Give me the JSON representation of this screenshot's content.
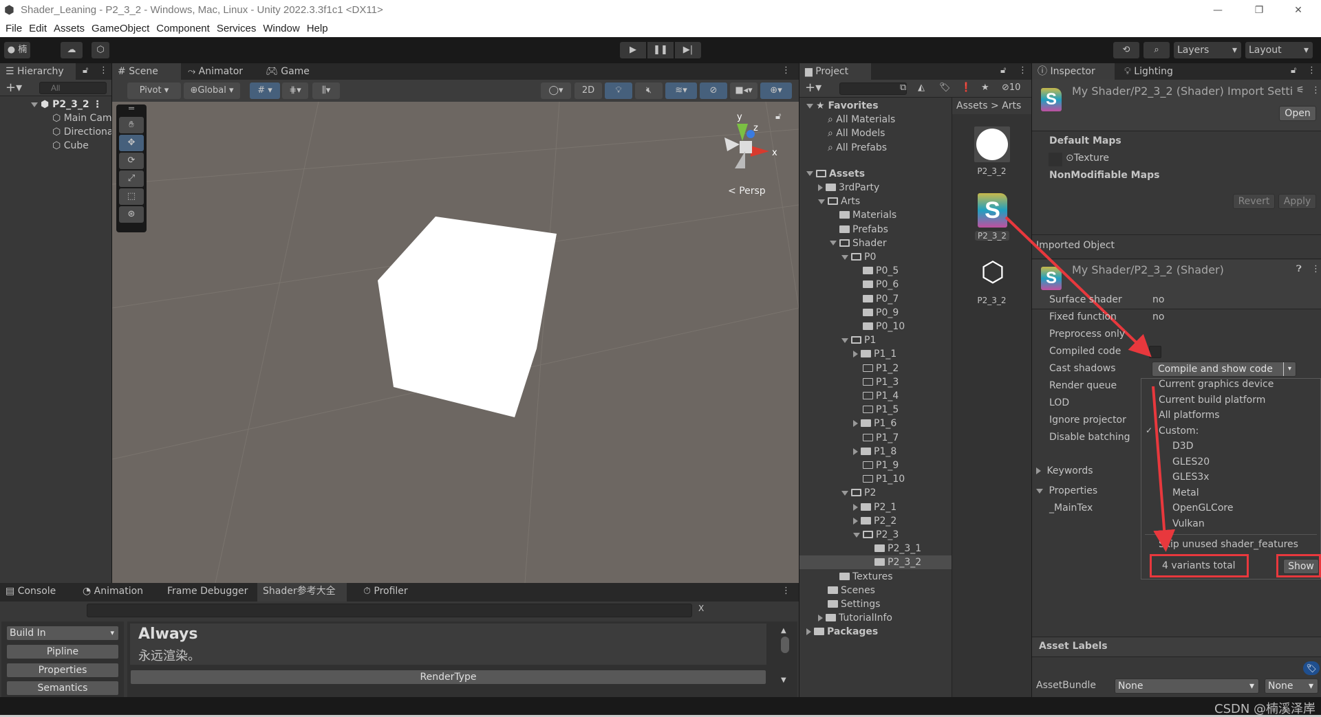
{
  "window": {
    "title": "Shader_Leaning - P2_3_2 - Windows, Mac, Linux - Unity 2022.3.3f1c1 <DX11>",
    "min": "—",
    "max": "❐",
    "close": "✕"
  },
  "menu": [
    "File",
    "Edit",
    "Assets",
    "GameObject",
    "Component",
    "Services",
    "Window",
    "Help"
  ],
  "toolbar": {
    "account": "楠",
    "layers": "Layers",
    "layout": "Layout"
  },
  "hierarchy": {
    "tab": "Hierarchy",
    "search_placeholder": "All",
    "scene": "P2_3_2",
    "items": [
      "Main Camera",
      "Directional Light",
      "Cube"
    ]
  },
  "scene": {
    "tabs": [
      "Scene",
      "Animator",
      "Game"
    ],
    "pivot": "Pivot",
    "global": "Global",
    "mode2d": "2D",
    "persp": "Persp",
    "axes": {
      "x": "x",
      "y": "y",
      "z": "z"
    }
  },
  "project": {
    "tab": "Project",
    "breadcrumb": [
      "Assets",
      "Arts"
    ],
    "hidden_count": "10",
    "tree": [
      {
        "label": "Favorites",
        "depth": 0,
        "type": "fav",
        "state": "open"
      },
      {
        "label": "All Materials",
        "depth": 1,
        "type": "search"
      },
      {
        "label": "All Models",
        "depth": 1,
        "type": "search"
      },
      {
        "label": "All Prefabs",
        "depth": 1,
        "type": "search"
      },
      {
        "label": "Assets",
        "depth": 0,
        "type": "folder",
        "state": "open",
        "gap": true
      },
      {
        "label": "3rdParty",
        "depth": 1,
        "type": "folder",
        "state": "closed"
      },
      {
        "label": "Arts",
        "depth": 1,
        "type": "folder",
        "state": "open"
      },
      {
        "label": "Materials",
        "depth": 2,
        "type": "folder"
      },
      {
        "label": "Prefabs",
        "depth": 2,
        "type": "folder"
      },
      {
        "label": "Shader",
        "depth": 2,
        "type": "folder",
        "state": "open"
      },
      {
        "label": "P0",
        "depth": 3,
        "type": "folder",
        "state": "open"
      },
      {
        "label": "P0_5",
        "depth": 4,
        "type": "folder"
      },
      {
        "label": "P0_6",
        "depth": 4,
        "type": "folder"
      },
      {
        "label": "P0_7",
        "depth": 4,
        "type": "folder"
      },
      {
        "label": "P0_9",
        "depth": 4,
        "type": "folder"
      },
      {
        "label": "P0_10",
        "depth": 4,
        "type": "folder"
      },
      {
        "label": "P1",
        "depth": 3,
        "type": "folder",
        "state": "open"
      },
      {
        "label": "P1_1",
        "depth": 4,
        "type": "folder",
        "state": "closed"
      },
      {
        "label": "P1_2",
        "depth": 4,
        "type": "emptyfolder"
      },
      {
        "label": "P1_3",
        "depth": 4,
        "type": "emptyfolder"
      },
      {
        "label": "P1_4",
        "depth": 4,
        "type": "emptyfolder"
      },
      {
        "label": "P1_5",
        "depth": 4,
        "type": "emptyfolder"
      },
      {
        "label": "P1_6",
        "depth": 4,
        "type": "folder",
        "state": "closed"
      },
      {
        "label": "P1_7",
        "depth": 4,
        "type": "emptyfolder"
      },
      {
        "label": "P1_8",
        "depth": 4,
        "type": "folder",
        "state": "closed"
      },
      {
        "label": "P1_9",
        "depth": 4,
        "type": "emptyfolder"
      },
      {
        "label": "P1_10",
        "depth": 4,
        "type": "emptyfolder"
      },
      {
        "label": "P2",
        "depth": 3,
        "type": "folder",
        "state": "open"
      },
      {
        "label": "P2_1",
        "depth": 4,
        "type": "folder",
        "state": "closed"
      },
      {
        "label": "P2_2",
        "depth": 4,
        "type": "folder",
        "state": "closed"
      },
      {
        "label": "P2_3",
        "depth": 4,
        "type": "folder",
        "state": "open"
      },
      {
        "label": "P2_3_1",
        "depth": 5,
        "type": "folder"
      },
      {
        "label": "P2_3_2",
        "depth": 5,
        "type": "folder",
        "selected": true
      },
      {
        "label": "Textures",
        "depth": 2,
        "type": "folder"
      },
      {
        "label": "Scenes",
        "depth": 1,
        "type": "folder"
      },
      {
        "label": "Settings",
        "depth": 1,
        "type": "folder"
      },
      {
        "label": "TutorialInfo",
        "depth": 1,
        "type": "folder",
        "state": "closed"
      },
      {
        "label": "Packages",
        "depth": 0,
        "type": "folder",
        "state": "closed"
      }
    ],
    "assets": [
      {
        "label": "P2_3_2",
        "kind": "material"
      },
      {
        "label": "P2_3_2",
        "kind": "shader"
      },
      {
        "label": "P2_3_2",
        "kind": "unity-prefab"
      }
    ]
  },
  "inspector": {
    "tabs": [
      "Inspector",
      "Lighting"
    ],
    "title": "My Shader/P2_3_2 (Shader) Import Setti",
    "open": "Open",
    "default_maps": "Default Maps",
    "texture": "Texture",
    "nonmod": "NonModifiable Maps",
    "revert": "Revert",
    "apply": "Apply",
    "imported_object": "Imported Object",
    "shader_title": "My Shader/P2_3_2 (Shader)",
    "props": [
      {
        "k": "Surface shader",
        "v": "no"
      },
      {
        "k": "Fixed function",
        "v": "no"
      },
      {
        "k": "Preprocess only",
        "v": ""
      },
      {
        "k": "Compiled code",
        "v": ""
      },
      {
        "k": "Cast shadows",
        "v": ""
      },
      {
        "k": "Render queue",
        "v": ""
      },
      {
        "k": "LOD",
        "v": ""
      },
      {
        "k": "Ignore projector",
        "v": ""
      },
      {
        "k": "Disable batching",
        "v": ""
      }
    ],
    "keywords": "Keywords",
    "properties": "Properties",
    "maintex": "_MainTex",
    "compile_button": "Compile and show code",
    "dropdown": {
      "items": [
        "Current graphics device",
        "Current build platform",
        "All platforms",
        "Custom:"
      ],
      "checked": "Custom:",
      "platforms": [
        "D3D",
        "GLES20",
        "GLES3x",
        "Metal",
        "OpenGLCore",
        "Vulkan"
      ],
      "skip": "Skip unused shader_features",
      "variants": "4 variants total",
      "show": "Show"
    },
    "asset_labels": "Asset Labels",
    "assetbundle": "AssetBundle",
    "bundle_value": "None",
    "variant_value": "None"
  },
  "bottom": {
    "tabs": [
      "Console",
      "Animation",
      "Frame Debugger",
      "Shader参考大全",
      "Profiler"
    ],
    "active_tab": "Shader参考大全",
    "build_in": "Build In",
    "side_buttons": [
      "Pipline",
      "Properties",
      "Semantics"
    ],
    "entry_title": "Always",
    "entry_desc": "永远渲染。",
    "render_type": "RenderType",
    "clear": "X"
  },
  "watermark": "CSDN @楠溪泽岸",
  "colors": {
    "accent": "#46607c",
    "annotation": "#e8383d",
    "scene_bg": "#6d6762"
  }
}
